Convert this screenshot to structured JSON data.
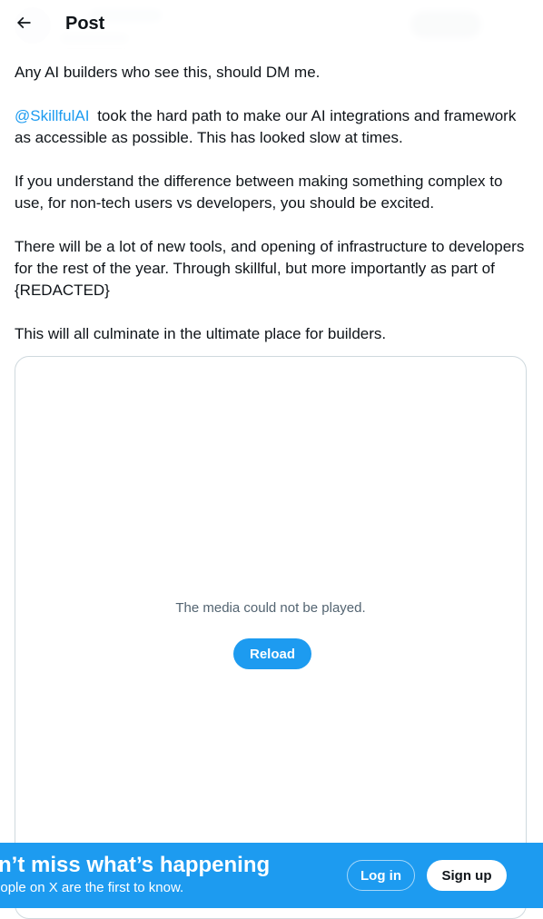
{
  "header": {
    "title": "Post",
    "back_icon": "arrow-left-icon"
  },
  "tweet": {
    "paragraphs": [
      "Any AI builders who see this, should DM me.",
      "took the hard path to make our AI integrations and framework as accessible as possible. This has looked slow at times.",
      "If you understand the difference between making something complex to use, for non-tech users vs developers, you should be excited.",
      "There will be a lot of new tools, and opening of infrastructure to developers for the rest of the year. Through skillful, but more importantly as part of {REDACTED}",
      "This will all culminate in the ultimate place for builders."
    ],
    "mention": "@SkillfulAI"
  },
  "media": {
    "error_text": "The media could not be played.",
    "reload_label": "Reload"
  },
  "bottom_banner": {
    "title": "Don’t miss what’s happening",
    "subtitle": "People on X are the first to know.",
    "login_label": "Log in",
    "signup_label": "Sign up"
  },
  "colors": {
    "accent": "#1d9bf0",
    "text_primary": "#0f1419",
    "text_secondary": "#536471",
    "border": "#cfd9de"
  }
}
